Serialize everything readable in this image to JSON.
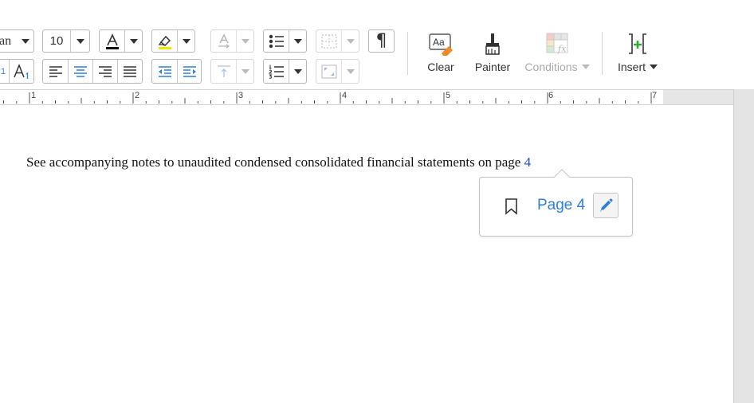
{
  "toolbar": {
    "font_name_fragment": "an",
    "font_size": "10",
    "clear_label": "Clear",
    "painter_label": "Painter",
    "conditions_label": "Conditions",
    "insert_label": "Insert"
  },
  "ruler": {
    "numbers": [
      "1",
      "2",
      "3",
      "4",
      "5",
      "6",
      "7"
    ]
  },
  "document": {
    "line_text": "See accompanying notes to unaudited condensed consolidated financial statements on page ",
    "link_text": "4"
  },
  "link_popup": {
    "label": "Page 4"
  },
  "colors": {
    "link": "#2f7fd8",
    "highlight": "#f5e600",
    "accent_orange": "#f08a24",
    "insert_plus": "#3aa63a"
  }
}
